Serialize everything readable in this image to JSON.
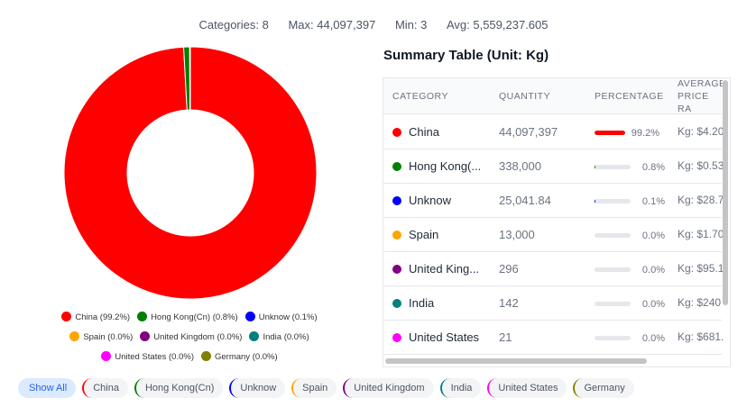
{
  "stats": {
    "categories": "Categories: 8",
    "max": "Max: 44,097,397",
    "min": "Min: 3",
    "avg": "Avg: 5,559,237.605"
  },
  "chart_data": {
    "type": "pie",
    "donut": true,
    "legend_position": "bottom",
    "categories": [
      "China",
      "Hong Kong(Cn)",
      "Unknow",
      "Spain",
      "United Kingdom",
      "India",
      "United States",
      "Germany"
    ],
    "values": [
      44097397,
      338000,
      25041.84,
      13000,
      296,
      142,
      21,
      3
    ],
    "percent_labels": [
      "China (99.2%)",
      "Hong Kong(Cn) (0.8%)",
      "Unknow (0.1%)",
      "Spain (0.0%)",
      "United Kingdom (0.0%)",
      "India (0.0%)",
      "United States (0.0%)",
      "Germany (0.0%)"
    ],
    "colors": [
      "#ff0000",
      "#008000",
      "#0000ff",
      "#ffa500",
      "#800080",
      "#008080",
      "#ff00ff",
      "#808000"
    ]
  },
  "table": {
    "title": "Summary Table (Unit: Kg)",
    "headers": [
      "CATEGORY",
      "QUANTITY",
      "PERCENTAGE",
      "AVERAGE PRICE RA"
    ],
    "rows": [
      {
        "name": "China",
        "qty": "44,097,397",
        "pct": "99.2%",
        "frac": 0.992,
        "price": "Kg: $4.20"
      },
      {
        "name": "Hong Kong(...",
        "qty": "338,000",
        "pct": "0.8%",
        "frac": 0.008,
        "price": "Kg: $0.53"
      },
      {
        "name": "Unknow",
        "qty": "25,041.84",
        "pct": "0.1%",
        "frac": 0.001,
        "price": "Kg: $28.7"
      },
      {
        "name": "Spain",
        "qty": "13,000",
        "pct": "0.0%",
        "frac": 0,
        "price": "Kg: $1.70"
      },
      {
        "name": "United King...",
        "qty": "296",
        "pct": "0.0%",
        "frac": 0,
        "price": "Kg: $95.1"
      },
      {
        "name": "India",
        "qty": "142",
        "pct": "0.0%",
        "frac": 0,
        "price": "Kg: $240"
      },
      {
        "name": "United States",
        "qty": "21",
        "pct": "0.0%",
        "frac": 0,
        "price": "Kg: $681."
      }
    ]
  },
  "chips": {
    "show_all": "Show All",
    "items": [
      "China",
      "Hong Kong(Cn)",
      "Unknow",
      "Spain",
      "United Kingdom",
      "India",
      "United States",
      "Germany"
    ]
  }
}
